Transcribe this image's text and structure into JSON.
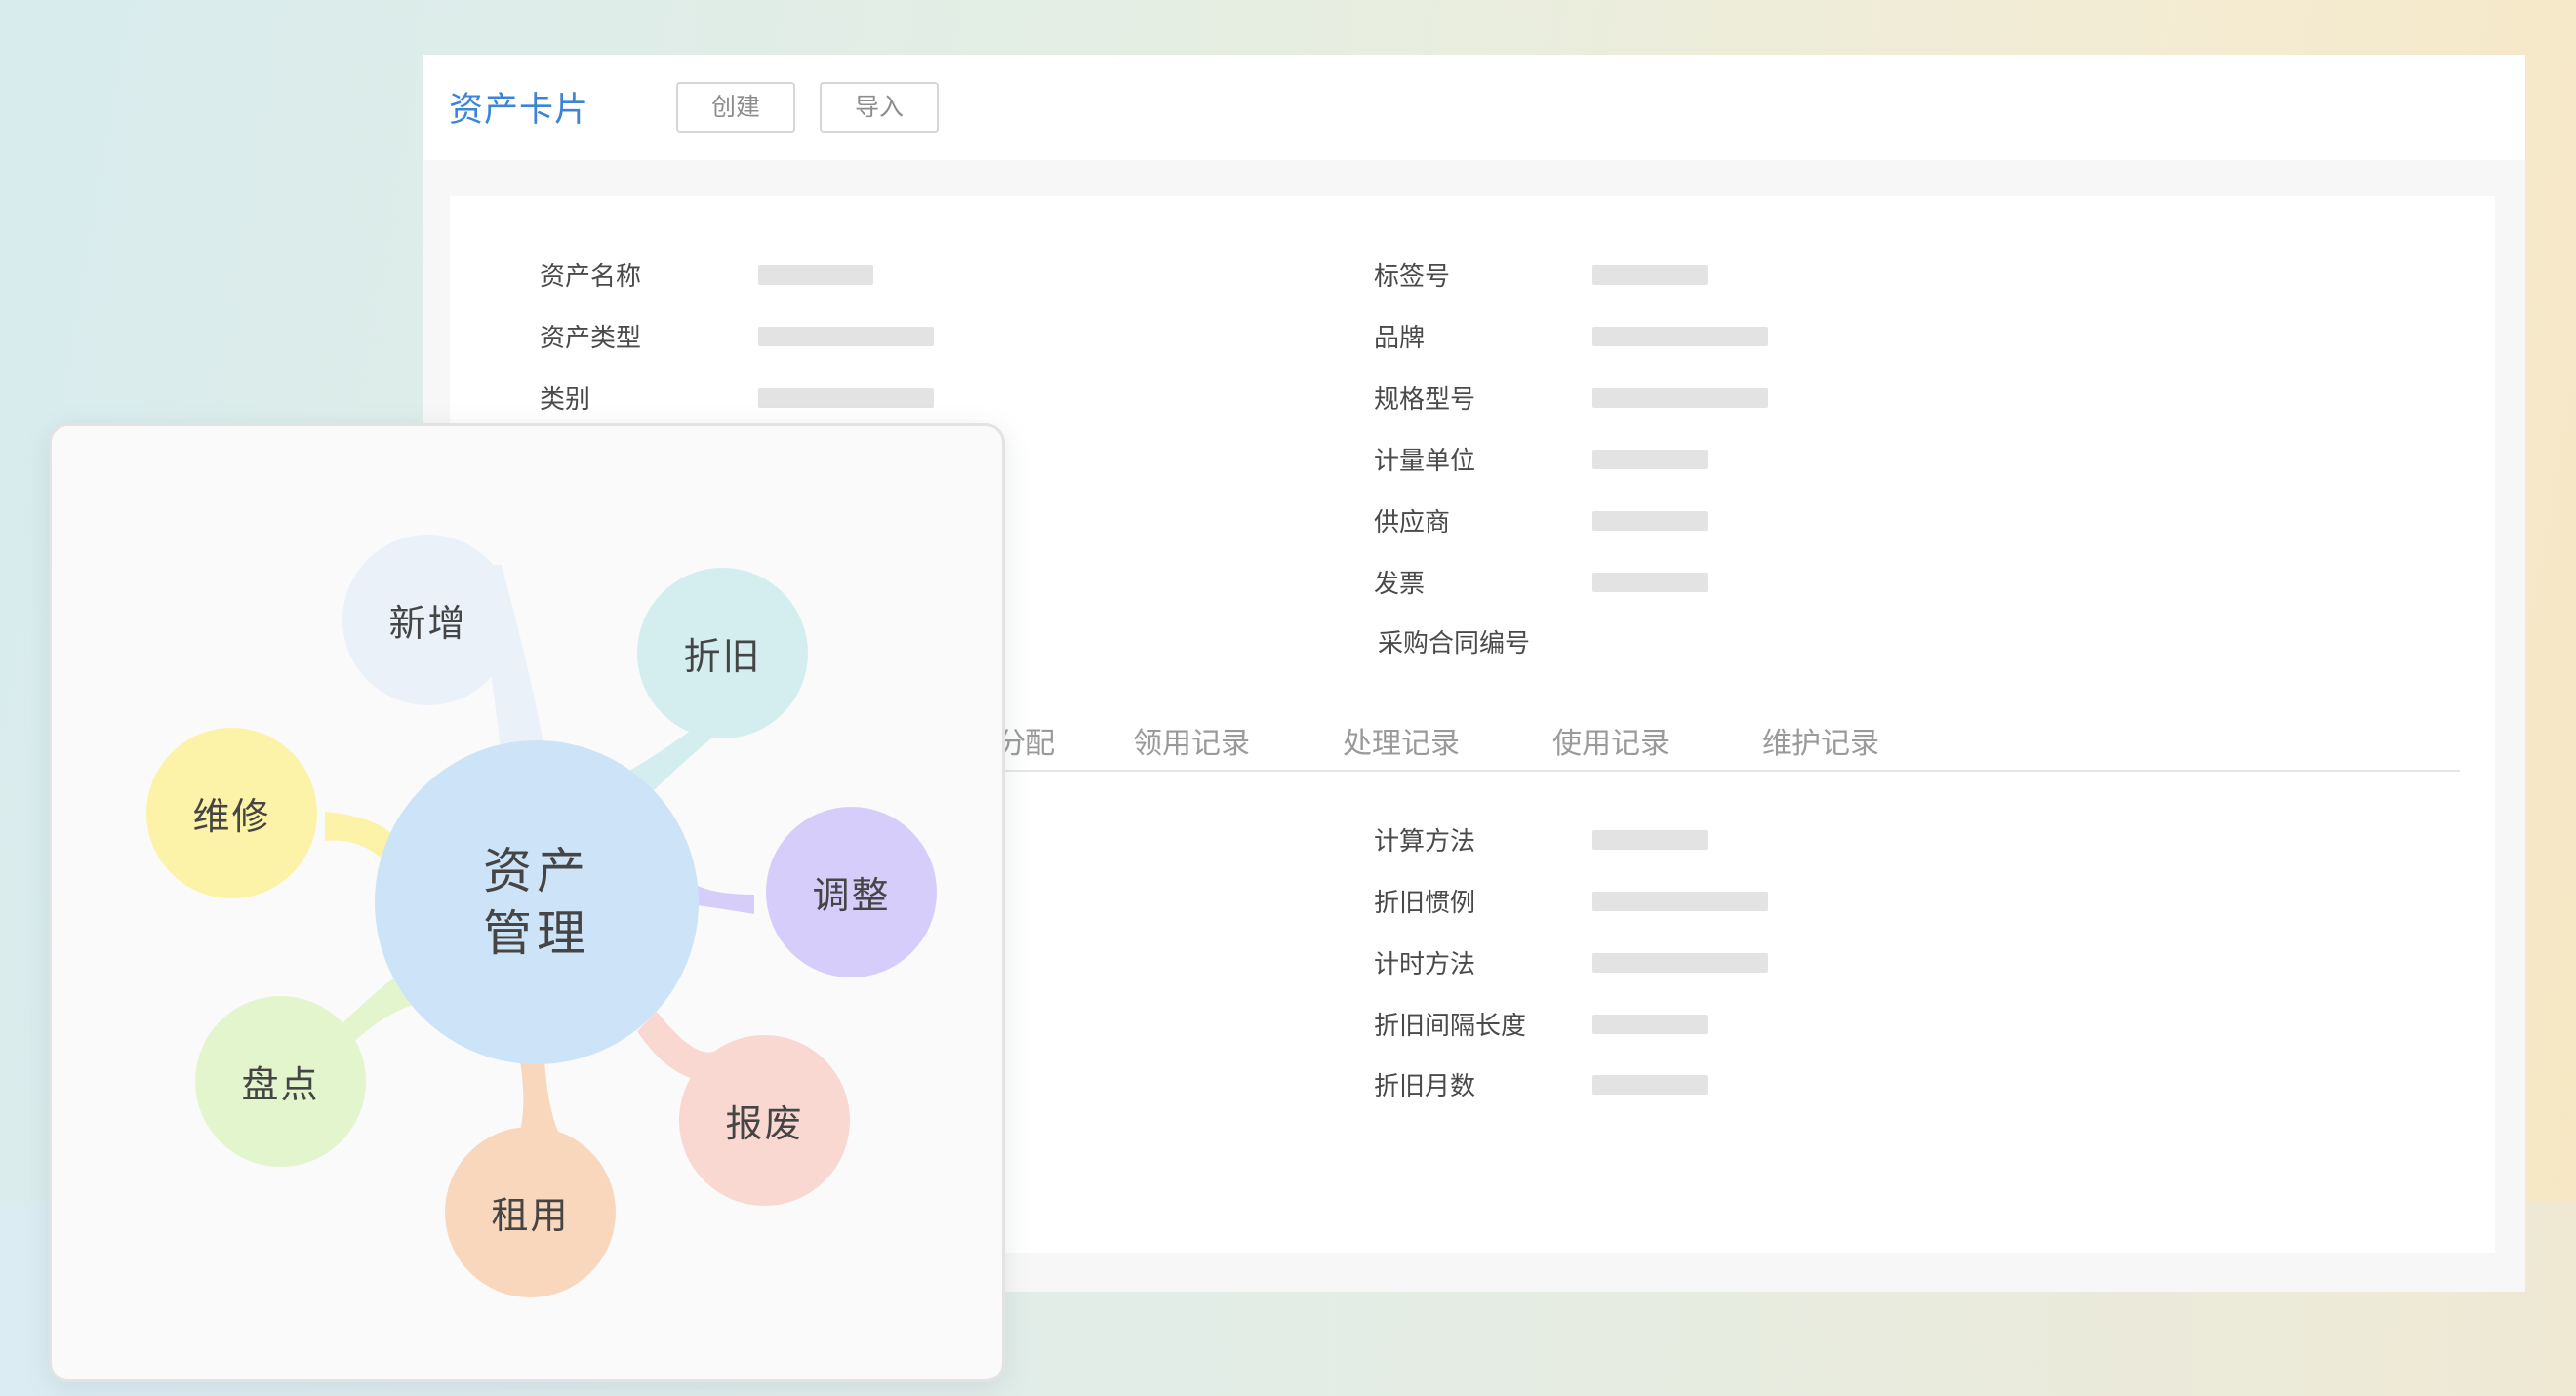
{
  "header": {
    "title": "资产卡片",
    "buttons": {
      "create": "创建",
      "import": "导入"
    }
  },
  "form": {
    "left_fields": [
      {
        "label": "资产名称"
      },
      {
        "label": "资产类型"
      },
      {
        "label": "类别"
      }
    ],
    "right_fields": [
      {
        "label": "标签号"
      },
      {
        "label": "品牌"
      },
      {
        "label": "规格型号"
      },
      {
        "label": "计量单位"
      },
      {
        "label": "供应商"
      },
      {
        "label": "发票"
      },
      {
        "label": "采购合同编号"
      }
    ]
  },
  "tabs": [
    {
      "label": "分配"
    },
    {
      "label": "领用记录"
    },
    {
      "label": "处理记录"
    },
    {
      "label": "使用记录"
    },
    {
      "label": "维护记录"
    }
  ],
  "depreciation_fields": [
    {
      "label": "计算方法"
    },
    {
      "label": "折旧惯例"
    },
    {
      "label": "计时方法"
    },
    {
      "label": "折旧间隔长度"
    },
    {
      "label": "折旧月数"
    }
  ],
  "mindmap": {
    "center": {
      "line1": "资产",
      "line2": "管理",
      "color": "#cde4f8"
    },
    "nodes": [
      {
        "label": "新增",
        "color": "#ebf1f9"
      },
      {
        "label": "折旧",
        "color": "#d4eef0"
      },
      {
        "label": "维修",
        "color": "#fcf3a8"
      },
      {
        "label": "调整",
        "color": "#d6cdfa"
      },
      {
        "label": "盘点",
        "color": "#e3f5cc"
      },
      {
        "label": "报废",
        "color": "#f9d8d1"
      },
      {
        "label": "租用",
        "color": "#f8d7bd"
      }
    ]
  }
}
